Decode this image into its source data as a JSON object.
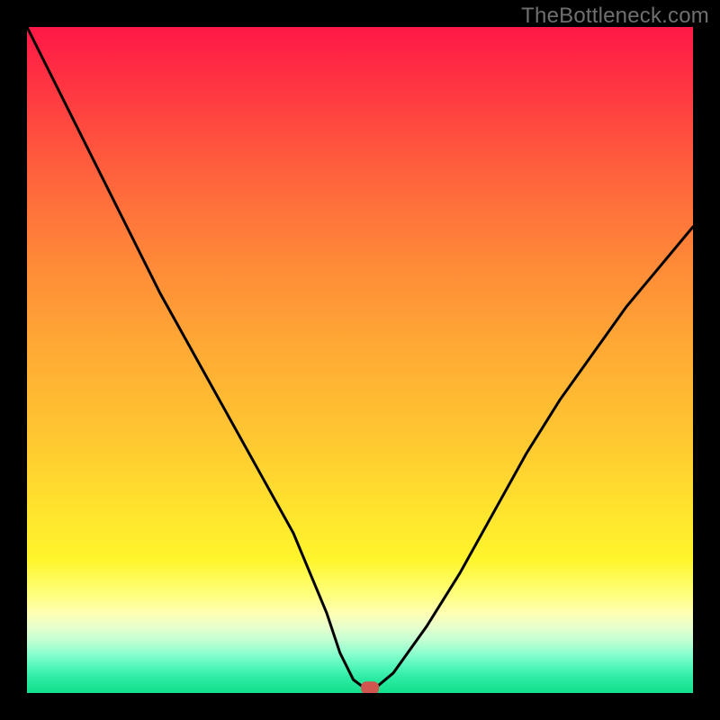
{
  "watermark": "TheBottleneck.com",
  "chart_data": {
    "type": "line",
    "title": "",
    "xlabel": "",
    "ylabel": "",
    "xlim": [
      0,
      100
    ],
    "ylim": [
      0,
      100
    ],
    "grid": false,
    "legend": false,
    "series": [
      {
        "name": "bottleneck-curve",
        "x": [
          0,
          5,
          10,
          15,
          20,
          25,
          30,
          35,
          40,
          45,
          47,
          49,
          51,
          52,
          55,
          60,
          65,
          70,
          75,
          80,
          85,
          90,
          95,
          100
        ],
        "values": [
          100,
          90,
          80,
          70,
          60,
          51,
          42,
          33,
          24,
          12,
          6,
          2,
          0.5,
          0.5,
          3,
          10,
          18,
          27,
          36,
          44,
          51,
          58,
          64,
          70
        ]
      }
    ],
    "marker": {
      "name": "current-point",
      "x": 51.5,
      "y": 0.5,
      "color": "#d0554f"
    },
    "gradient_stops": [
      {
        "pos": 0,
        "color": "#ff1847"
      },
      {
        "pos": 50,
        "color": "#ffae36"
      },
      {
        "pos": 80,
        "color": "#fff52c"
      },
      {
        "pos": 100,
        "color": "#14df8d"
      }
    ]
  }
}
